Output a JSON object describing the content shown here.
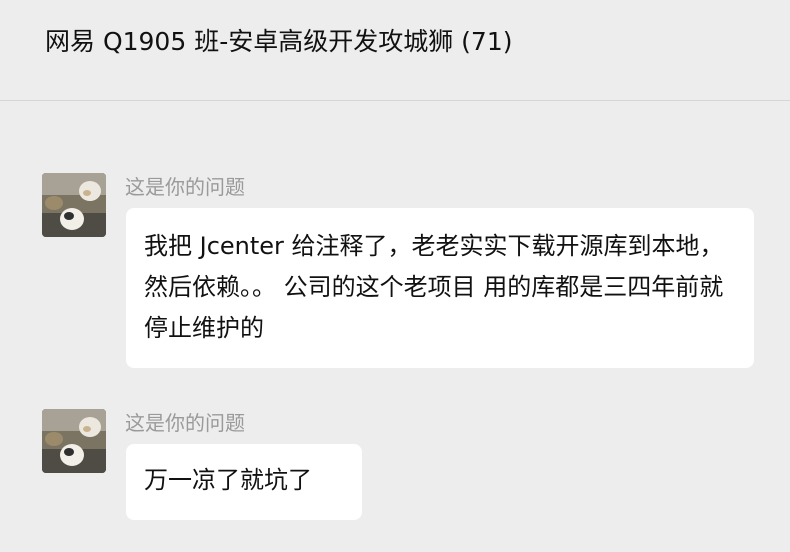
{
  "header": {
    "title": "网易 Q1905 班-安卓高级开发攻城狮 (71)"
  },
  "messages": [
    {
      "sender": "这是你的问题",
      "text": "我把 Jcenter 给注释了，老老实实下载开源库到本地，然后依赖。。 公司的这个老项目 用的库都是三四年前就停止维护的"
    },
    {
      "sender": "这是你的问题",
      "text": "万一凉了就坑了"
    }
  ]
}
